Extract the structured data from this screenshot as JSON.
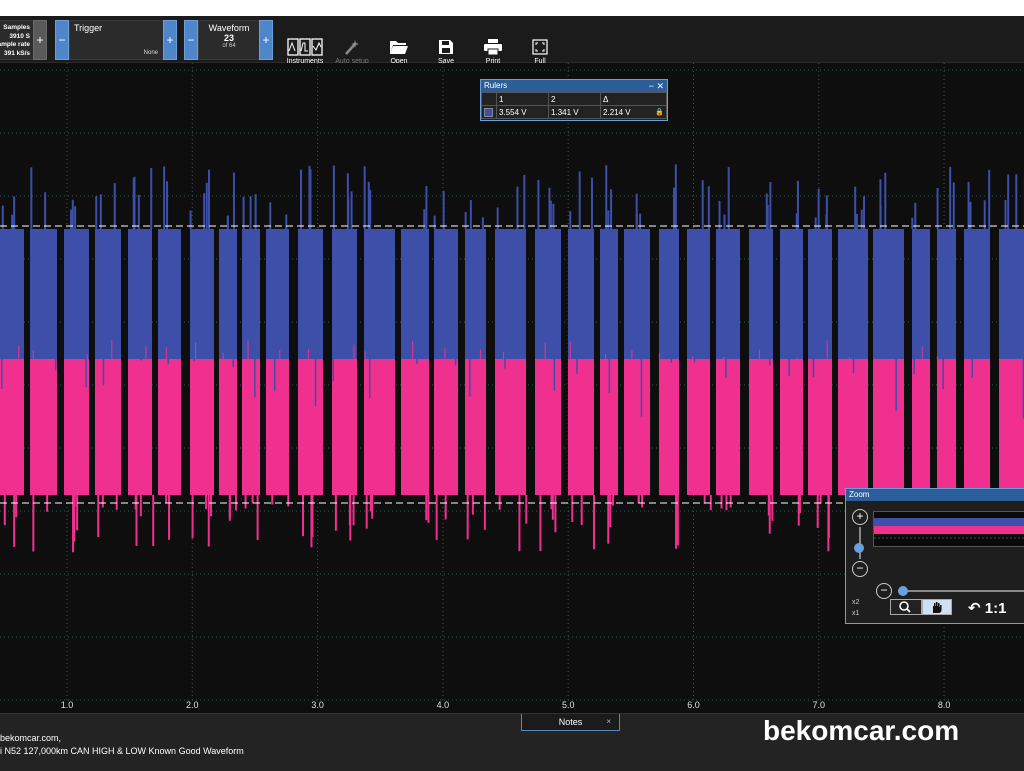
{
  "toolbar": {
    "samples": {
      "line1": "Samples",
      "line2": "3910 S",
      "line3": "ample rate",
      "line4": "391 kS/s"
    },
    "trigger": {
      "label": "Trigger",
      "mode": "None"
    },
    "waveform": {
      "label": "Waveform",
      "current": "23",
      "of": "of 64"
    },
    "tools": [
      {
        "name": "instruments",
        "label": "Instruments",
        "icon": "instruments-icon"
      },
      {
        "name": "auto-setup",
        "label": "Auto setup",
        "icon": "wand-icon"
      },
      {
        "name": "open",
        "label": "Open",
        "icon": "folder-icon"
      },
      {
        "name": "save",
        "label": "Save",
        "icon": "save-icon"
      },
      {
        "name": "print",
        "label": "Print",
        "icon": "printer-icon"
      },
      {
        "name": "full",
        "label": "Full",
        "icon": "fullscreen-icon"
      }
    ],
    "minus": "−",
    "plus": "+"
  },
  "rulers": {
    "title": "Rulers",
    "col1": "1",
    "col2": "2",
    "col3": "Δ",
    "v1": "3.554 V",
    "v2": "1.341 V",
    "delta": "2.214 V",
    "min": "−",
    "close": "✕"
  },
  "zoom": {
    "title": "Zoom",
    "plus": "+",
    "minus": "−",
    "x2": "x2",
    "x1": "x1",
    "reset": "1:1"
  },
  "x_axis": [
    "1.0",
    "2.0",
    "3.0",
    "4.0",
    "5.0",
    "6.0",
    "7.0",
    "8.0"
  ],
  "notes": {
    "tab_label": "Notes",
    "close": "×",
    "line1": "bekomcar.com,",
    "line2": "i N52 127,000km CAN HIGH & LOW Known Good Waveform"
  },
  "brand": "bekomcar.com",
  "colors": {
    "can_high": "#3d4fa8",
    "can_low": "#f0308f",
    "accent": "#4e86c9"
  }
}
